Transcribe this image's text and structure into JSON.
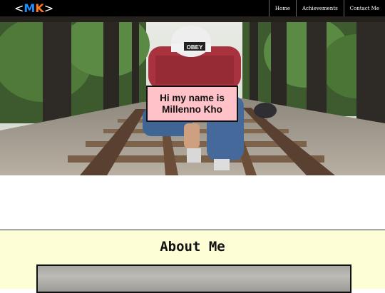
{
  "header": {
    "logo": {
      "open": "<",
      "m": "M",
      "k": "K",
      "close": ">"
    },
    "nav": [
      "Home",
      "Achievements",
      "Contact Me"
    ]
  },
  "hero": {
    "name_line1": "Hi my name is",
    "name_line2": "Millenno Kho",
    "cap_text": "OBEY"
  },
  "about": {
    "title": "About Me"
  },
  "colors": {
    "logo_m": "#1e90ff",
    "logo_k": "#ff7a1a",
    "name_box_bg": "#ffc2c8",
    "about_bg": "#fdfdd6"
  }
}
